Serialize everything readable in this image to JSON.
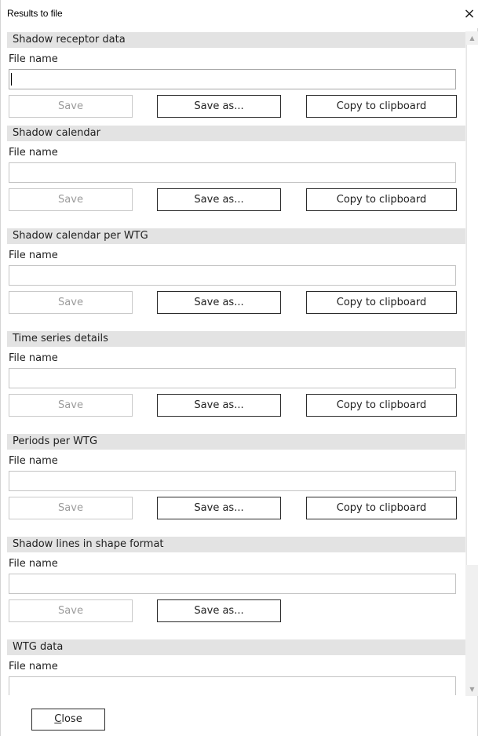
{
  "window": {
    "title": "Results to file",
    "close_glyph": "×"
  },
  "sections": [
    {
      "title": "Shadow receptor data",
      "file_label": "File name",
      "file_value": "",
      "save_label": "Save",
      "save_as_label": "Save as...",
      "copy_label": "Copy to clipboard"
    },
    {
      "title": "Shadow calendar",
      "file_label": "File name",
      "file_value": "",
      "save_label": "Save",
      "save_as_label": "Save as...",
      "copy_label": "Copy to clipboard"
    },
    {
      "title": "Shadow calendar per WTG",
      "file_label": "File name",
      "file_value": "",
      "save_label": "Save",
      "save_as_label": "Save as...",
      "copy_label": "Copy to clipboard"
    },
    {
      "title": "Time series details",
      "file_label": "File name",
      "file_value": "",
      "save_label": "Save",
      "save_as_label": "Save as...",
      "copy_label": "Copy to clipboard"
    },
    {
      "title": "Periods per WTG",
      "file_label": "File name",
      "file_value": "",
      "save_label": "Save",
      "save_as_label": "Save as...",
      "copy_label": "Copy to clipboard"
    },
    {
      "title": "Shadow lines in shape format",
      "file_label": "File name",
      "file_value": "",
      "save_label": "Save",
      "save_as_label": "Save as..."
    },
    {
      "title": "WTG data",
      "file_label": "File name",
      "file_value": ""
    }
  ],
  "scrollbar": {
    "up_glyph": "▲",
    "down_glyph": "▼"
  },
  "footer": {
    "close_mnemonic": "C",
    "close_rest": "lose"
  },
  "colors": {
    "section_header_bg": "#e3e3e3",
    "disabled_text": "#9b9b9b",
    "button_border": "#2b2b2b"
  }
}
